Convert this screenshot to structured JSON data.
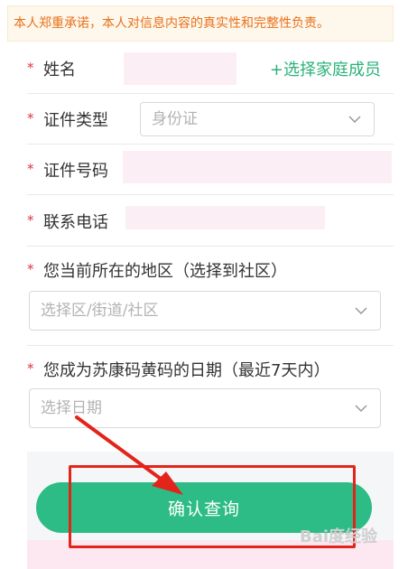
{
  "notice": {
    "text": "本人郑重承诺，本人对信息内容的真实性和完整性负责。"
  },
  "required_mark": "*",
  "fields": {
    "name": {
      "label": "姓名",
      "add_member_label": "+选择家庭成员"
    },
    "id_type": {
      "label": "证件类型",
      "value": "身份证"
    },
    "id_number": {
      "label": "证件号码"
    },
    "phone": {
      "label": "联系电话"
    },
    "region": {
      "label": "您当前所在的地区（选择到社区）",
      "placeholder": "选择区/街道/社区"
    },
    "date": {
      "label": "您成为苏康码黄码的日期（最近7天内）",
      "placeholder": "选择日期"
    }
  },
  "confirm_button": {
    "label": "确认查询"
  },
  "watermark": {
    "text": "Bai度经验"
  },
  "colors": {
    "accent_green": "#2dbc85",
    "link_green": "#2bb27a",
    "notice_text": "#e8711a",
    "required_red": "#d9383c",
    "annotation_red": "#e3241b"
  },
  "icons": {
    "dropdown": "chevron-down-icon",
    "arrow": "red-arrow-annotation"
  }
}
